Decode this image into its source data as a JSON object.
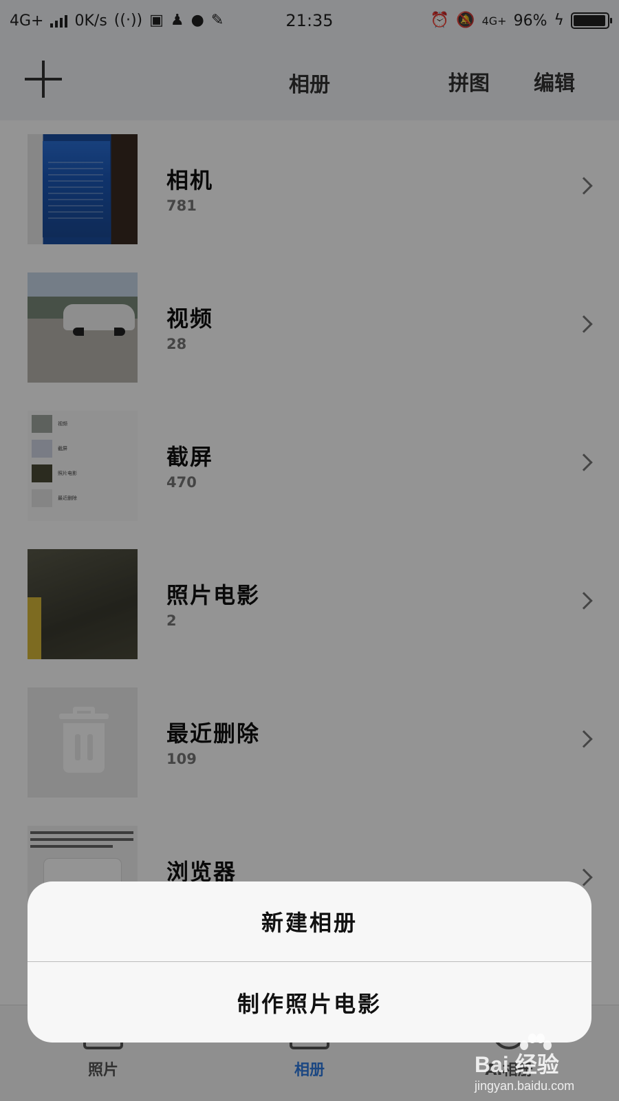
{
  "status_bar": {
    "network_type": "4G+",
    "speed": "0K/s",
    "time": "21:35",
    "signal_type": "4G+",
    "battery_percent": "96%",
    "battery_level": 0.96
  },
  "header": {
    "title": "相册",
    "collage_label": "拼图",
    "edit_label": "编辑"
  },
  "albums": [
    {
      "name": "相机",
      "count": "781"
    },
    {
      "name": "视频",
      "count": "28"
    },
    {
      "name": "截屏",
      "count": "470"
    },
    {
      "name": "照片电影",
      "count": "2"
    },
    {
      "name": "最近删除",
      "count": "109"
    },
    {
      "name": "浏览器",
      "count": ""
    }
  ],
  "screenshot_thumb": {
    "lines": [
      "视频",
      "截屏",
      "照片电影",
      "最近删除"
    ]
  },
  "action_sheet": {
    "new_album": "新建相册",
    "make_photo_movie": "制作照片电影"
  },
  "bottom_nav": {
    "photos": "照片",
    "albums": "相册",
    "ai": "AI相册"
  },
  "watermark": {
    "brand": "Bai 经验",
    "url": "jingyan.baidu.com"
  },
  "colors": {
    "accent": "#2f7be0",
    "overlay": "rgba(0,0,0,0.42)"
  }
}
